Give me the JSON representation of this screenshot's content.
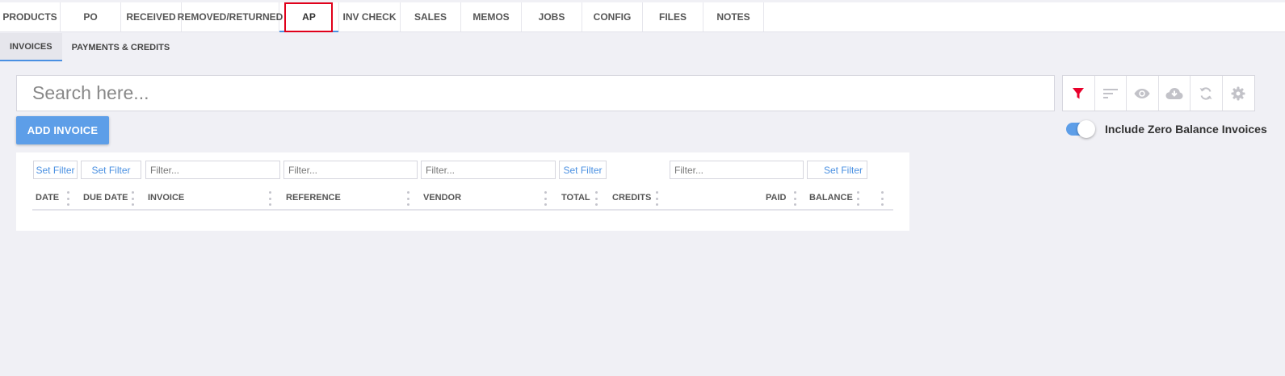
{
  "main_tabs": [
    {
      "label": "PRODUCTS",
      "active": false
    },
    {
      "label": "PO",
      "active": false
    },
    {
      "label": "RECEIVED",
      "active": false
    },
    {
      "label": "REMOVED/RETURNED",
      "active": false
    },
    {
      "label": "AP",
      "active": true
    },
    {
      "label": "INV CHECK",
      "active": false
    },
    {
      "label": "SALES",
      "active": false
    },
    {
      "label": "MEMOS",
      "active": false
    },
    {
      "label": "JOBS",
      "active": false
    },
    {
      "label": "CONFIG",
      "active": false
    },
    {
      "label": "FILES",
      "active": false
    },
    {
      "label": "NOTES",
      "active": false
    }
  ],
  "sub_tabs": [
    {
      "label": "INVOICES",
      "active": true
    },
    {
      "label": "PAYMENTS & CREDITS",
      "active": false
    }
  ],
  "search": {
    "placeholder": "Search here...",
    "value": ""
  },
  "toolbar": {
    "icons": [
      "filter-icon",
      "sort-icon",
      "eye-icon",
      "cloud-download-icon",
      "refresh-icon",
      "gear-icon"
    ],
    "filter_active_color": "#e8002b",
    "icon_color": "#c2c2c8"
  },
  "add_button_label": "ADD INVOICE",
  "toggle": {
    "label": "Include Zero Balance Invoices",
    "on": true
  },
  "grid": {
    "filters": {
      "date": "Set Filter",
      "due_date": "Set Filter",
      "invoice": "Filter...",
      "reference": "Filter...",
      "vendor": "Filter...",
      "total": "Set Filter",
      "paid": "Filter...",
      "balance": "Set Filter"
    },
    "columns": {
      "date": "DATE",
      "due_date": "DUE DATE",
      "invoice": "INVOICE",
      "reference": "REFERENCE",
      "vendor": "VENDOR",
      "total": "TOTAL",
      "credits": "CREDITS",
      "paid": "PAID",
      "balance": "BALANCE"
    },
    "rows": []
  },
  "colors": {
    "accent": "#4a90e2",
    "button": "#5d9ee8",
    "highlight_box": "#e0001a",
    "background": "#f0f0f5"
  }
}
